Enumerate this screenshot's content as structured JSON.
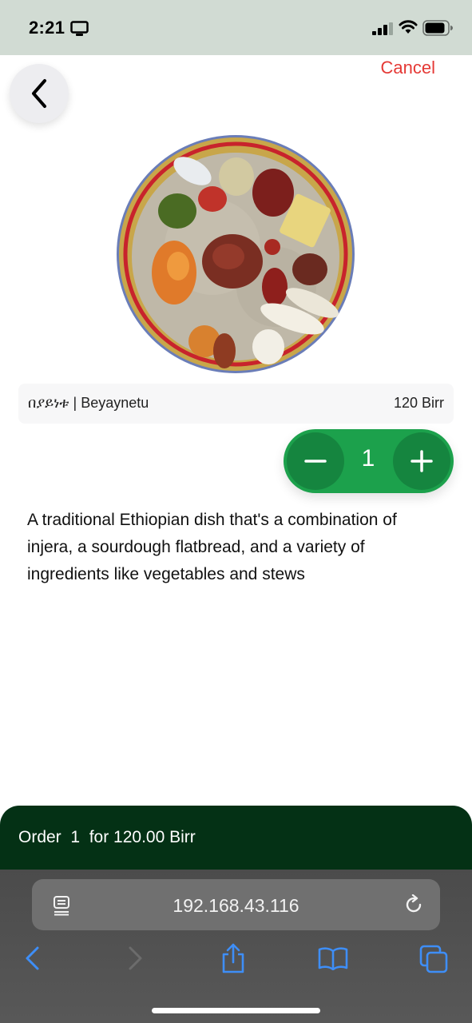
{
  "status_bar": {
    "time": "2:21",
    "icons": [
      "screen-mirroring-icon",
      "cellular-signal-icon",
      "wifi-icon",
      "battery-icon"
    ]
  },
  "header": {
    "back_icon": "chevron-left-icon",
    "cancel_label": "Cancel"
  },
  "dish": {
    "image": "ethiopian-platter-photo",
    "name": "በያይነቱ | Beyaynetu",
    "price": "120 Birr",
    "quantity": "1",
    "description": "A traditional Ethiopian dish that's a combination of injera, a sourdough flatbread, and a variety of ingredients like vegetables and stews"
  },
  "order_bar": {
    "label": "Order  1  for 120.00 Birr"
  },
  "browser": {
    "url": "192.168.43.116",
    "toolbar_icons": [
      "back-icon",
      "forward-icon",
      "share-icon",
      "bookmarks-icon",
      "tabs-icon"
    ]
  },
  "colors": {
    "status_bar_bg": "#d1dbd3",
    "cancel": "#e53935",
    "stepper": "#1ca14c",
    "order_bar": "#043115",
    "browser_accent": "#3e8ef7"
  }
}
